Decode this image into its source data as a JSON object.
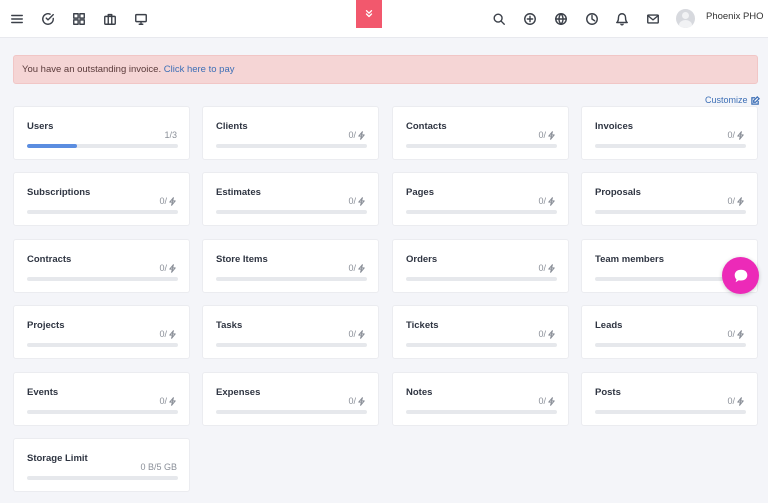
{
  "header": {
    "user_name": "Phoenix PHO"
  },
  "alert": {
    "text": "You have an outstanding invoice. ",
    "link": "Click here to pay"
  },
  "customize_label": "Customize",
  "cards": [
    {
      "title": "Users",
      "count": "1/3",
      "progress": 0.33,
      "unlimited": false
    },
    {
      "title": "Clients",
      "count": "0/",
      "progress": 0,
      "unlimited": true
    },
    {
      "title": "Contacts",
      "count": "0/",
      "progress": 0,
      "unlimited": true
    },
    {
      "title": "Invoices",
      "count": "0/",
      "progress": 0,
      "unlimited": true
    },
    {
      "title": "Subscriptions",
      "count": "0/",
      "progress": 0,
      "unlimited": true
    },
    {
      "title": "Estimates",
      "count": "0/",
      "progress": 0,
      "unlimited": true
    },
    {
      "title": "Pages",
      "count": "0/",
      "progress": 0,
      "unlimited": true
    },
    {
      "title": "Proposals",
      "count": "0/",
      "progress": 0,
      "unlimited": true
    },
    {
      "title": "Contracts",
      "count": "0/",
      "progress": 0,
      "unlimited": true
    },
    {
      "title": "Store Items",
      "count": "0/",
      "progress": 0,
      "unlimited": true
    },
    {
      "title": "Orders",
      "count": "0/",
      "progress": 0,
      "unlimited": true
    },
    {
      "title": "Team members",
      "count": "",
      "progress": 0,
      "unlimited": false
    },
    {
      "title": "Projects",
      "count": "0/",
      "progress": 0,
      "unlimited": true
    },
    {
      "title": "Tasks",
      "count": "0/",
      "progress": 0,
      "unlimited": true
    },
    {
      "title": "Tickets",
      "count": "0/",
      "progress": 0,
      "unlimited": true
    },
    {
      "title": "Leads",
      "count": "0/",
      "progress": 0,
      "unlimited": true
    },
    {
      "title": "Events",
      "count": "0/",
      "progress": 0,
      "unlimited": true
    },
    {
      "title": "Expenses",
      "count": "0/",
      "progress": 0,
      "unlimited": true
    },
    {
      "title": "Notes",
      "count": "0/",
      "progress": 0,
      "unlimited": true
    },
    {
      "title": "Posts",
      "count": "0/",
      "progress": 0,
      "unlimited": true
    },
    {
      "title": "Storage Limit",
      "count": "0 B/5 GB",
      "progress": 0,
      "unlimited": false
    }
  ],
  "colors": {
    "accent_red": "#f2586d",
    "progress_blue": "#5b8de0",
    "chat_pink": "#ec2ab8",
    "alert_bg": "#f5d5d5",
    "link_blue": "#3d6fb6"
  },
  "icons": {
    "left": [
      "menu-icon",
      "check-circle-icon",
      "grid-icon",
      "briefcase-icon",
      "monitor-icon"
    ],
    "right": [
      "search-icon",
      "plus-circle-icon",
      "globe-icon",
      "clock-icon",
      "bell-icon",
      "mail-icon"
    ]
  }
}
